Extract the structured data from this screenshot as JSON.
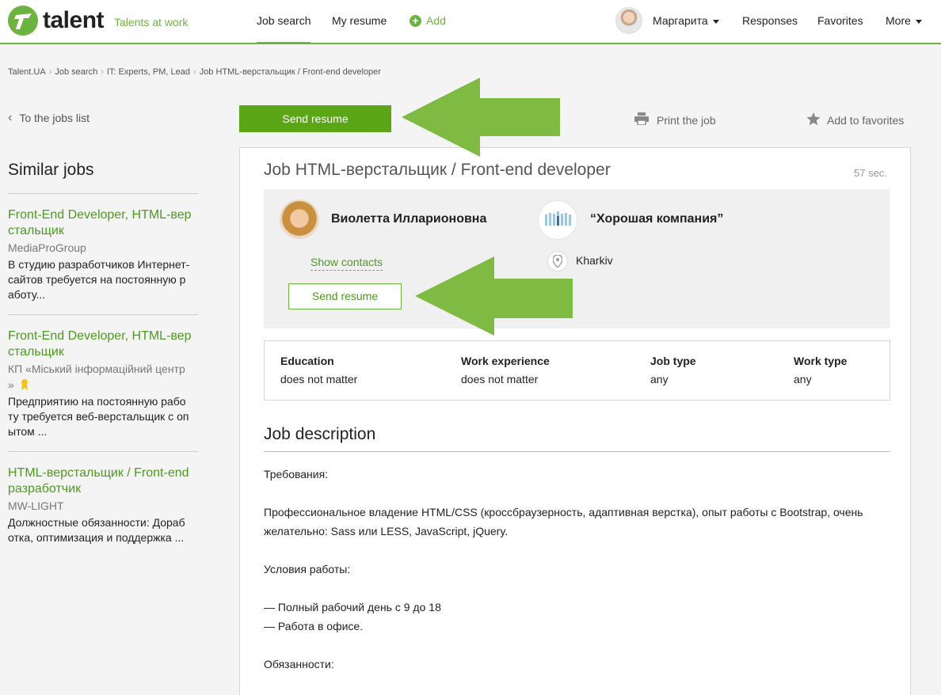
{
  "header": {
    "logo_text": "talent",
    "tagline": "Talents at work",
    "nav": {
      "job_search": "Job search",
      "my_resume": "My resume",
      "add": "Add",
      "user": "Маргарита",
      "responses": "Responses",
      "favorites": "Favorites",
      "more": "More"
    }
  },
  "breadcrumbs": [
    "Talent.UA",
    "Job search",
    "IT: Experts, PM, Lead",
    "Job HTML-верстальщик / Front-end developer"
  ],
  "left": {
    "back_link": "To the jobs list",
    "similar_title": "Similar jobs",
    "jobs": [
      {
        "title": "Front-End Developer, HTML-вер\nстальщик",
        "company": "MediaProGroup",
        "desc": "В студию разработчиков Интернет-\nсайтов требуется на постоянную р\nаботу..."
      },
      {
        "title": "Front-End Developer, HTML-вер\nстальщик",
        "company": "КП «Міський інформаційний центр\n»",
        "desc": "Предприятию на постоянную рабо\nту требуется веб-верстальщик с оп\nытом ..."
      },
      {
        "title": "HTML-верстальщик / Front-end\nразработчик",
        "company": "MW-LIGHT",
        "desc": "Должностные обязанности: Дораб\nотка, оптимизация и поддержка ..."
      }
    ]
  },
  "actions": {
    "send_resume": "Send resume",
    "print": "Print the job",
    "add_favorites": "Add to favorites"
  },
  "job": {
    "title": "Job HTML-верстальщик / Front-end developer",
    "posted": "57 sec.",
    "contact_name": "Виолетта Илларионовна",
    "company": "“Хорошая компания”",
    "show_contacts": "Show contacts",
    "send_resume": "Send resume",
    "city": "Kharkiv",
    "info": [
      {
        "label": "Education",
        "value": "does not matter"
      },
      {
        "label": "Work experience",
        "value": "does not matter"
      },
      {
        "label": "Job type",
        "value": "any"
      },
      {
        "label": "Work type",
        "value": "any"
      }
    ],
    "description_heading": "Job description",
    "description_lines": [
      "Требования:",
      "Профессиональное владение HTML/CSS (кроссбраузерность, адаптивная верстка), опыт работы с Bootstrap, очень",
      "желательно: Sass или LESS, JavaScript, jQuery.",
      "Условия работы:",
      "— Полный рабочий день с 9 до 18",
      "— Работа в офисе.",
      "Обязанности:"
    ]
  },
  "colors": {
    "brand_green": "#6cb33f",
    "button_green": "#5aa617",
    "arrow_green": "#7fba42"
  }
}
